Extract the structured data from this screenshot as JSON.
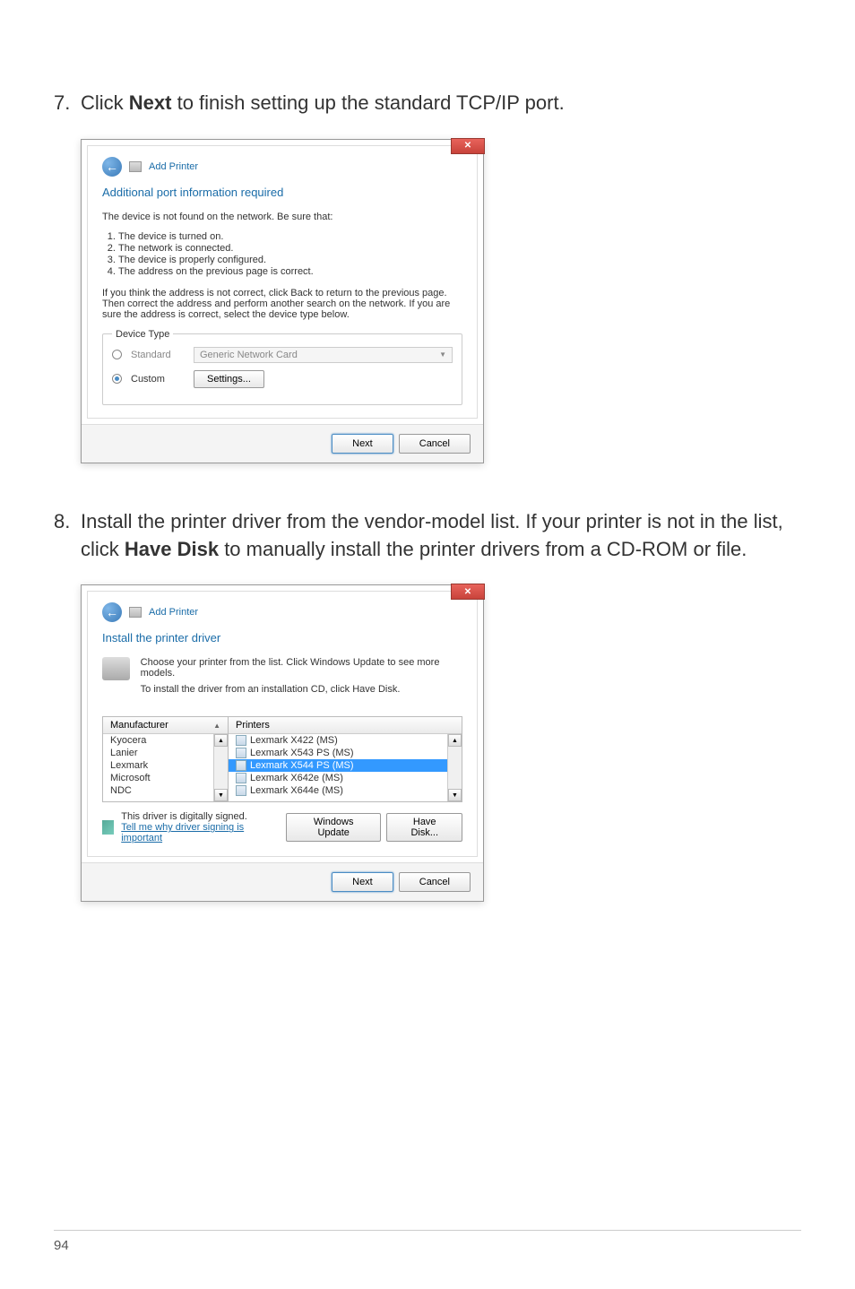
{
  "step7": {
    "num": "7.",
    "pre": "Click ",
    "bold": "Next",
    "post": " to finish setting up the standard TCP/IP port."
  },
  "step8": {
    "num": "8.",
    "pre": "Install the printer driver from the vendor-model list. If your printer is not in the list, click ",
    "bold": "Have Disk",
    "post": " to manually install the printer drivers from a CD-ROM or file."
  },
  "dialog1": {
    "title": "Add Printer",
    "section": "Additional port information required",
    "intro": "The device is not found on the network. Be sure that:",
    "list": [
      "The device is turned on.",
      "The network is connected.",
      "The device is properly configured.",
      "The address on the previous page is correct."
    ],
    "paragraph": "If you think the address is not correct, click Back to return to the previous page. Then correct the address and perform another search on the network. If you are sure the address is correct, select the device type below.",
    "fieldset": "Device Type",
    "standard": "Standard",
    "dropdown": "Generic Network Card",
    "custom": "Custom",
    "settings": "Settings...",
    "next": "Next",
    "cancel": "Cancel"
  },
  "dialog2": {
    "title": "Add Printer",
    "section": "Install the printer driver",
    "line1": "Choose your printer from the list. Click Windows Update to see more models.",
    "line2": "To install the driver from an installation CD, click Have Disk.",
    "manufacturer": "Manufacturer",
    "printers": "Printers",
    "mfg_list": [
      "Kyocera",
      "Lanier",
      "Lexmark",
      "Microsoft",
      "NDC"
    ],
    "printer_list": [
      {
        "label": "Lexmark X422 (MS)",
        "selected": false
      },
      {
        "label": "Lexmark X543 PS (MS)",
        "selected": false
      },
      {
        "label": "Lexmark X544 PS (MS)",
        "selected": true
      },
      {
        "label": "Lexmark X642e (MS)",
        "selected": false
      },
      {
        "label": "Lexmark X644e (MS)",
        "selected": false
      }
    ],
    "signed": "This driver is digitally signed.",
    "link": "Tell me why driver signing is important",
    "winupdate": "Windows Update",
    "havedisk": "Have Disk...",
    "next": "Next",
    "cancel": "Cancel"
  },
  "page_number": "94"
}
